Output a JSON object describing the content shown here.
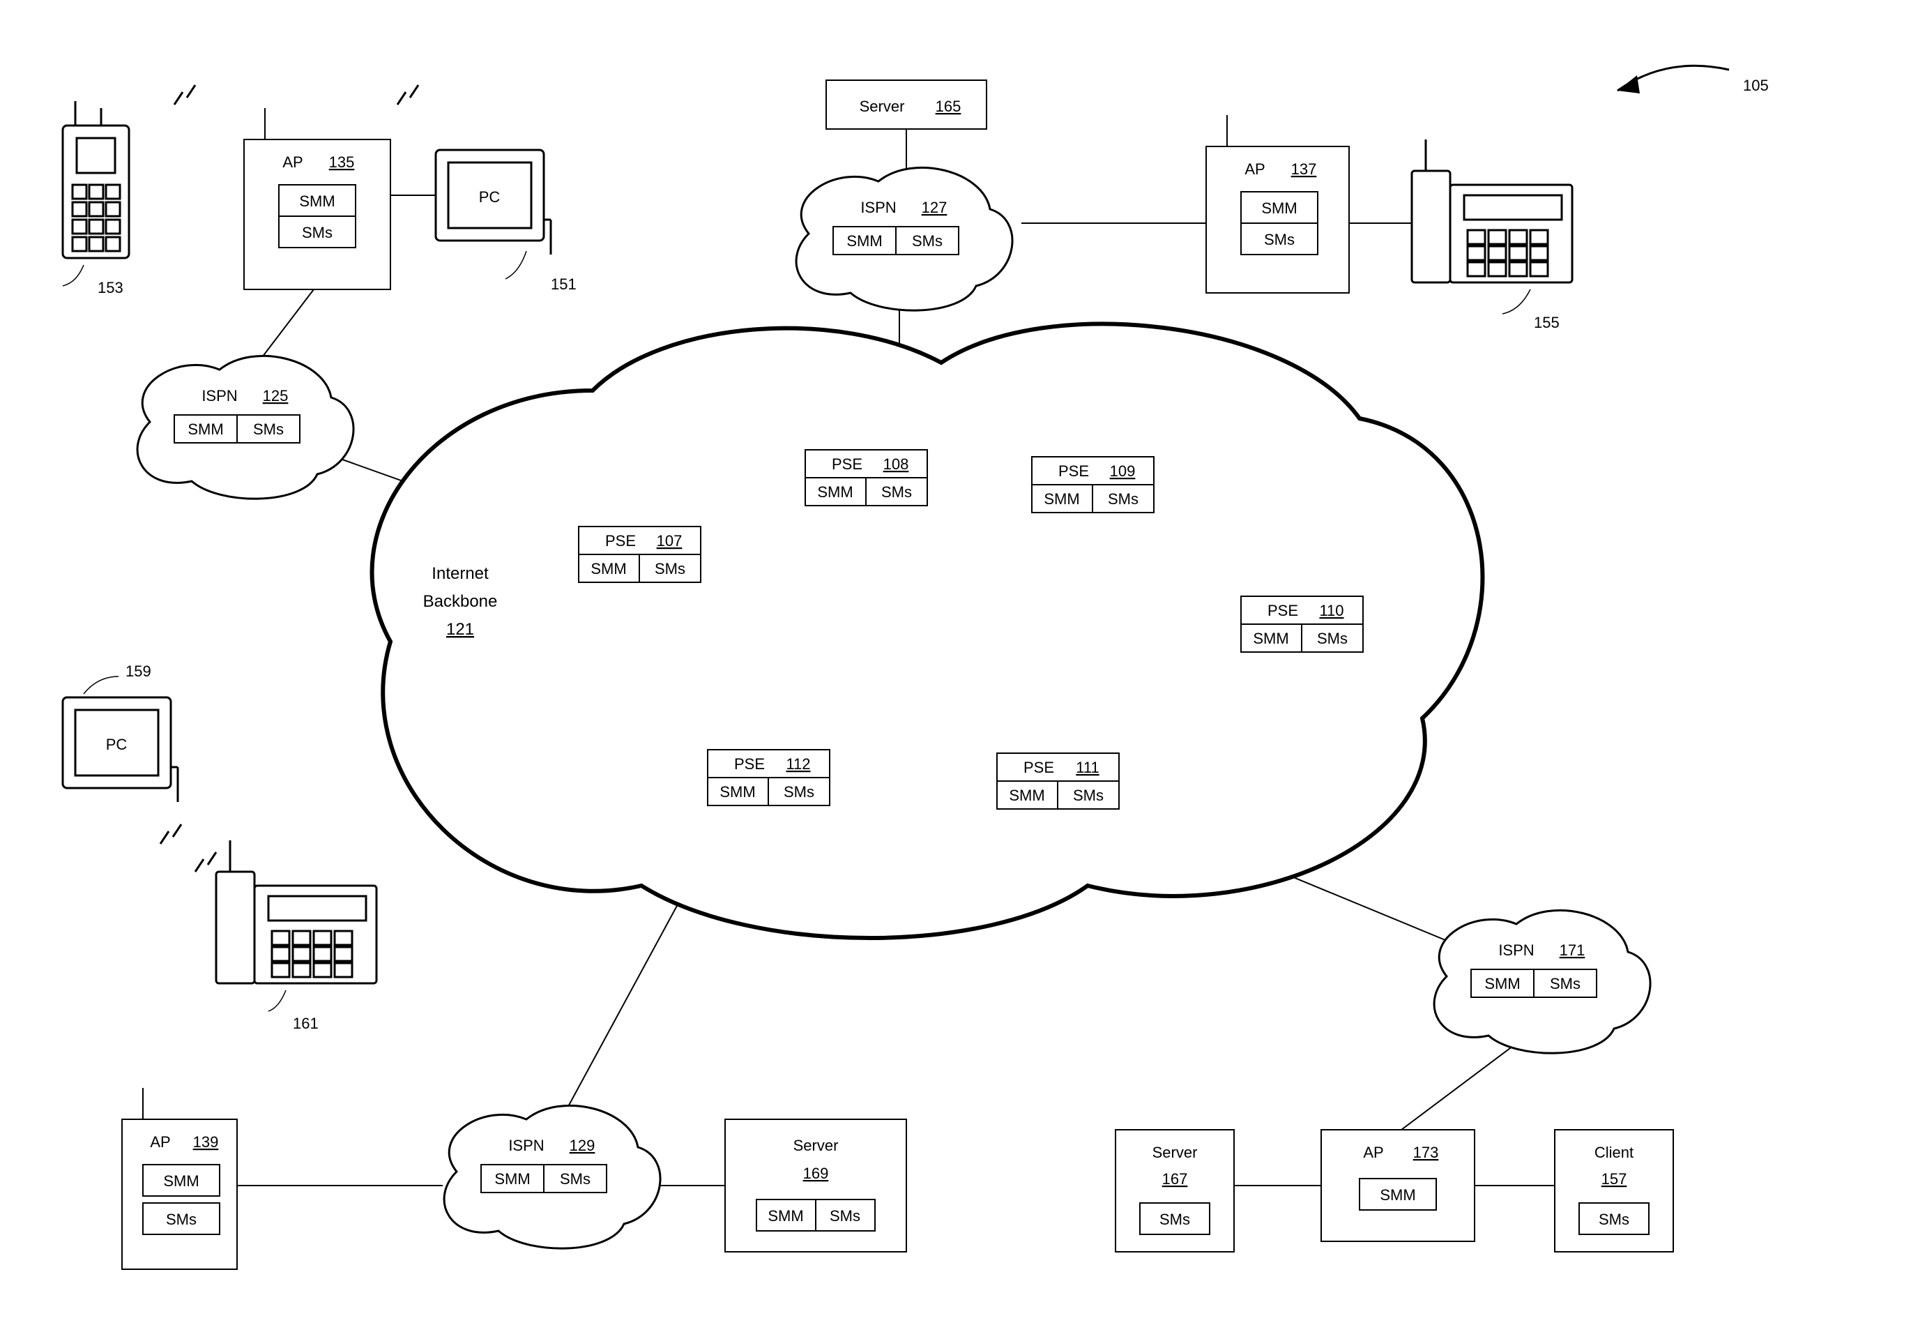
{
  "figref": "105",
  "backbone": {
    "title1": "Internet",
    "title2": "Backbone",
    "ref": "121"
  },
  "pse": {
    "p107": {
      "title": "PSE",
      "ref": "107",
      "smm": "SMM",
      "sms": "SMs"
    },
    "p108": {
      "title": "PSE",
      "ref": "108",
      "smm": "SMM",
      "sms": "SMs"
    },
    "p109": {
      "title": "PSE",
      "ref": "109",
      "smm": "SMM",
      "sms": "SMs"
    },
    "p110": {
      "title": "PSE",
      "ref": "110",
      "smm": "SMM",
      "sms": "SMs"
    },
    "p111": {
      "title": "PSE",
      "ref": "111",
      "smm": "SMM",
      "sms": "SMs"
    },
    "p112": {
      "title": "PSE",
      "ref": "112",
      "smm": "SMM",
      "sms": "SMs"
    }
  },
  "ispn": {
    "i125": {
      "title": "ISPN",
      "ref": "125",
      "smm": "SMM",
      "sms": "SMs"
    },
    "i127": {
      "title": "ISPN",
      "ref": "127",
      "smm": "SMM",
      "sms": "SMs"
    },
    "i129": {
      "title": "ISPN",
      "ref": "129",
      "smm": "SMM",
      "sms": "SMs"
    },
    "i171": {
      "title": "ISPN",
      "ref": "171",
      "smm": "SMM",
      "sms": "SMs"
    }
  },
  "ap": {
    "a135": {
      "title": "AP",
      "ref": "135",
      "smm": "SMM",
      "sms": "SMs"
    },
    "a137": {
      "title": "AP",
      "ref": "137",
      "smm": "SMM",
      "sms": "SMs"
    },
    "a139": {
      "title": "AP",
      "ref": "139",
      "smm": "SMM",
      "sms": "SMs"
    },
    "a173": {
      "title": "AP",
      "ref": "173",
      "smm": "SMM"
    }
  },
  "server": {
    "s165": {
      "title": "Server",
      "ref": "165"
    },
    "s167": {
      "title": "Server",
      "ref": "167",
      "sms": "SMs"
    },
    "s169": {
      "title": "Server",
      "ref": "169",
      "smm": "SMM",
      "sms": "SMs"
    }
  },
  "client": {
    "c157": {
      "title": "Client",
      "ref": "157",
      "sms": "SMs"
    }
  },
  "pc": {
    "p151": {
      "label": "PC",
      "ref": "151"
    },
    "p159": {
      "label": "PC",
      "ref": "159"
    }
  },
  "phone": {
    "ph153": {
      "ref": "153"
    },
    "ph155": {
      "ref": "155"
    },
    "ph161": {
      "ref": "161"
    }
  }
}
